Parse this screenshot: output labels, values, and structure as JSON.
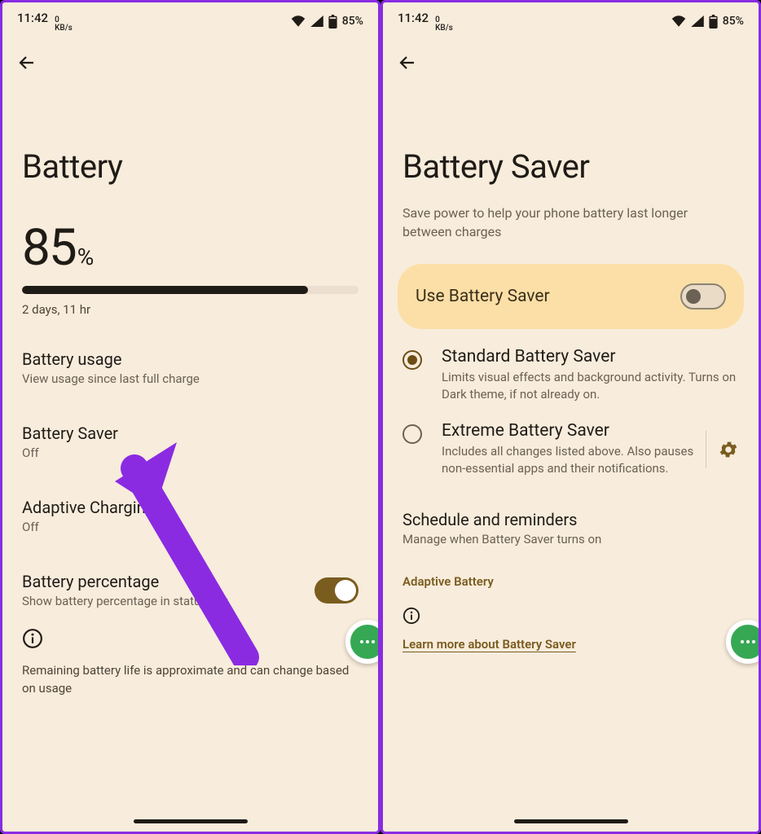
{
  "status": {
    "time": "11:42",
    "netrate_top": "0",
    "netrate_bottom": "KB/s",
    "battery": "85%"
  },
  "left": {
    "title": "Battery",
    "pct_num": "85",
    "pct_sign": "%",
    "bar_fill_pct": 85,
    "eta": "2 days, 11 hr",
    "usage": {
      "title": "Battery usage",
      "sub": "View usage since last full charge"
    },
    "saver": {
      "title": "Battery Saver",
      "sub": "Off"
    },
    "adaptive": {
      "title": "Adaptive Charging",
      "sub": "Off"
    },
    "percentage": {
      "title": "Battery percentage",
      "sub": "Show battery percentage in status bar"
    },
    "footnote": "Remaining battery life is approximate and can change based on usage"
  },
  "right": {
    "title": "Battery Saver",
    "subtitle": "Save power to help your phone battery last longer between charges",
    "use_saver_label": "Use Battery Saver",
    "standard": {
      "title": "Standard Battery Saver",
      "sub": "Limits visual effects and background activity. Turns on Dark theme, if not already on."
    },
    "extreme": {
      "title": "Extreme Battery Saver",
      "sub": "Includes all changes listed above. Also pauses non-essential apps and their notifications."
    },
    "schedule": {
      "title": "Schedule and reminders",
      "sub": "Manage when Battery Saver turns on"
    },
    "adaptive_link": "Adaptive Battery",
    "learn_link": "Learn more about Battery Saver"
  }
}
